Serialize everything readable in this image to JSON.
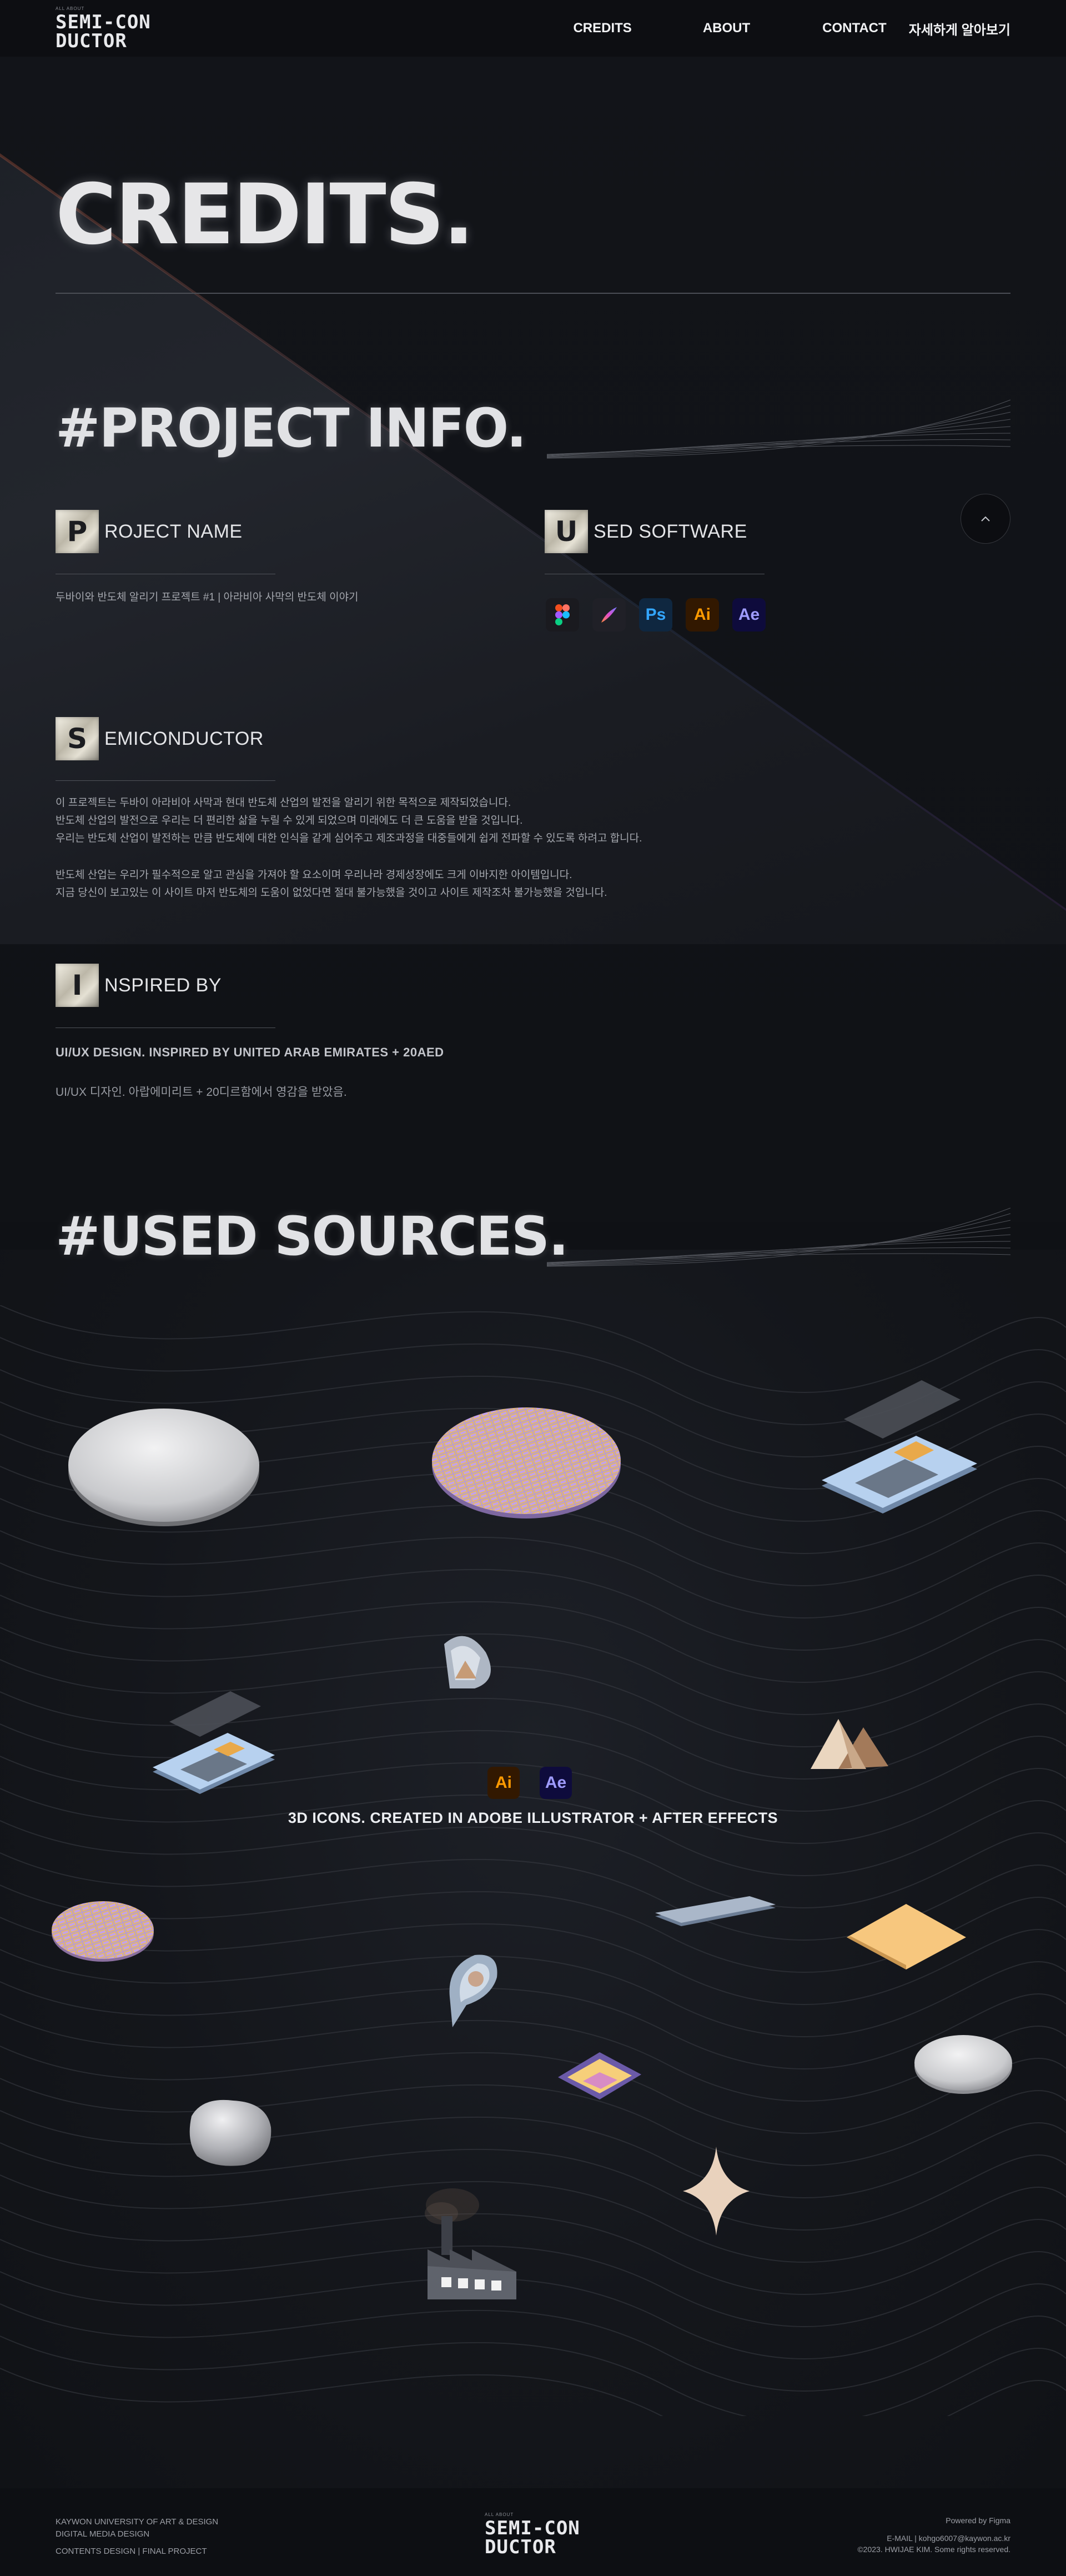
{
  "header": {
    "logo_small": "ALL ABOUT",
    "logo_line1": "SEMI-CON",
    "logo_line2": "DUCTOR",
    "nav": [
      "CREDITS",
      "ABOUT",
      "CONTACT",
      "자세하게 알아보기"
    ]
  },
  "page": {
    "title": "CREDITS."
  },
  "project_info": {
    "heading": "#PROJECT INFO.",
    "project_name": {
      "letter": "P",
      "label": "ROJECT NAME",
      "text": "두바이와 반도체 알리기 프로젝트 #1 | 아라비아 사막의 반도체 이야기"
    },
    "used_software": {
      "letter": "U",
      "label": "SED SOFTWARE",
      "icons": [
        "figma-icon",
        "procreate-icon",
        "Ps",
        "Ai",
        "Ae"
      ]
    },
    "semiconductor": {
      "letter": "S",
      "label": "EMICONDUCTOR",
      "lines": [
        "이 프로젝트는 두바이 아라비아 사막과 현대 반도체 산업의 발전을 알리기 위한 목적으로 제작되었습니다.",
        "반도체 산업의 발전으로 우리는 더 편리한 삶을 누릴 수 있게 되었으며 미래에도 더 큰 도움을 받을 것입니다.",
        "우리는 반도체 산업이 발전하는 만큼 반도체에 대한 인식을 같게 심어주고 제조과정을 대중들에게 쉽게 전파할 수 있도록 하려고 합니다.",
        "반도체 산업는 우리가 필수적으로 알고 관심을 가져야 할 요소이며 우리나라 경제성장에도 크게 이바지한 아이템입니다.",
        "지금 당신이 보고있는 이 사이트 마저 반도체의 도움이 없었다면 절대 불가능했을 것이고 사이트 제작조차 불가능했을 것입니다."
      ]
    },
    "inspired_by": {
      "letter": "I",
      "label": "NSPIRED BY",
      "line_en": "UI/UX DESIGN. INSPIRED BY UNITED ARAB EMIRATES + 20AED",
      "line_kr": "UI/UX 디자인. 아랍에미리트 + 20디르함에서 영감을 받았음."
    }
  },
  "used_sources": {
    "heading": "#USED SOURCES.",
    "tools": [
      "Ai",
      "Ae"
    ],
    "caption": "3D ICONS. CREATED IN ADOBE ILLUSTRATOR + AFTER EFFECTS"
  },
  "footer": {
    "left": [
      "KAYWON UNIVERSITY OF ART & DESIGN",
      "DIGITAL MEDIA DESIGN",
      "CONTENTS DESIGN | FINAL PROJECT"
    ],
    "logo_small": "ALL ABOUT",
    "logo_line1": "SEMI-CON",
    "logo_line2": "DUCTOR",
    "right": [
      "Powered by Figma",
      "E-MAIL | kohgo6007@kaywon.ac.kr",
      "©2023. HWIJAE KIM. Some rights reserved."
    ]
  },
  "colors": {
    "background": "#0f1115",
    "text": "#e6e6e8",
    "accent_ai": "#ff9a00",
    "accent_ae": "#9f9bff",
    "accent_ps": "#33a6ff"
  }
}
